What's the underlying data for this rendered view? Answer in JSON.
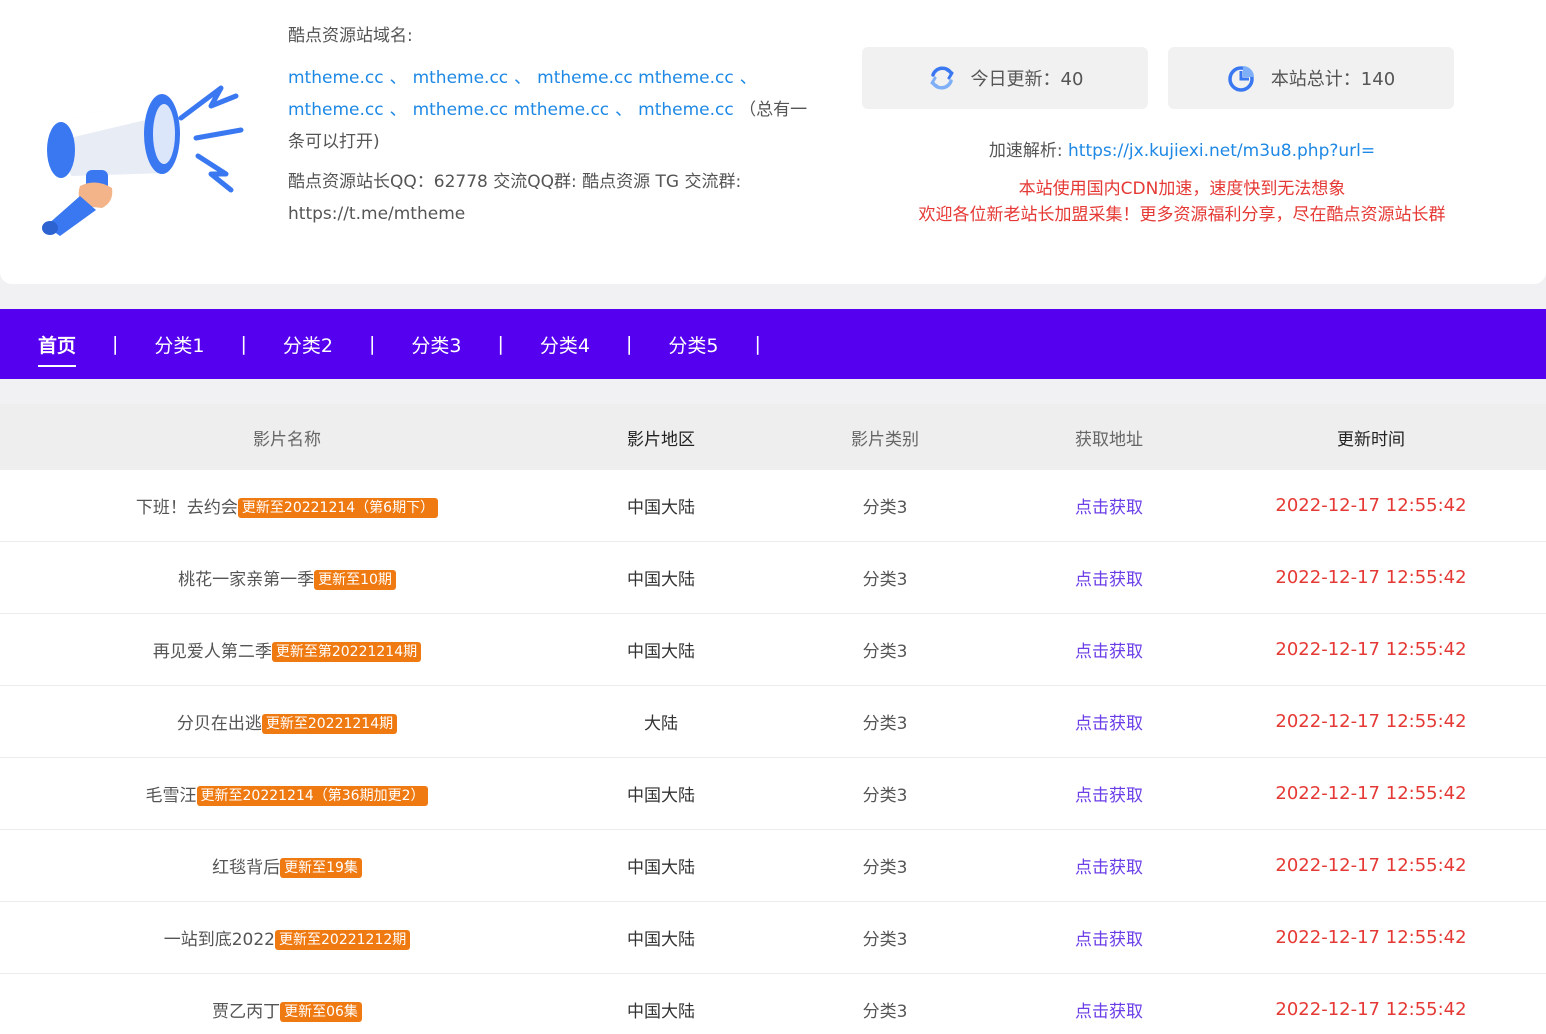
{
  "header": {
    "domain_title": "酷点资源站域名:",
    "domains": [
      "mtheme.cc",
      "mtheme.cc",
      "mtheme.cc mtheme.cc",
      "mtheme.cc",
      "mtheme.cc mtheme.cc",
      "mtheme.cc"
    ],
    "domain_note": "（总有一条可以打开)",
    "contact_line1": "酷点资源站长QQ：62778 交流QQ群: 酷点资源 TG 交流群:",
    "contact_line2": "https://t.me/mtheme",
    "stats": {
      "today_label": "今日更新：40",
      "total_label": "本站总计：140"
    },
    "accel_label": "加速解析: ",
    "accel_url": "https://jx.kujiexi.net/m3u8.php?url=",
    "notice_line1": "本站使用国内CDN加速，速度快到无法想象",
    "notice_line2": "欢迎各位新老站长加盟采集！更多资源福利分享，尽在酷点资源站长群"
  },
  "nav": {
    "items": [
      "首页",
      "分类1",
      "分类2",
      "分类3",
      "分类4",
      "分类5"
    ],
    "separator": "|",
    "active_index": 0
  },
  "table": {
    "headers": [
      "影片名称",
      "影片地区",
      "影片类别",
      "获取地址",
      "更新时间"
    ],
    "rows": [
      {
        "title": "下班！去约会",
        "badge": "更新至20221214（第6期下）",
        "region": "中国大陆",
        "category": "分类3",
        "link": "点击获取",
        "time": "2022-12-17 12:55:42"
      },
      {
        "title": "桃花一家亲第一季",
        "badge": "更新至10期",
        "region": "中国大陆",
        "category": "分类3",
        "link": "点击获取",
        "time": "2022-12-17 12:55:42"
      },
      {
        "title": "再见爱人第二季",
        "badge": "更新至第20221214期",
        "region": "中国大陆",
        "category": "分类3",
        "link": "点击获取",
        "time": "2022-12-17 12:55:42"
      },
      {
        "title": "分贝在出逃",
        "badge": "更新至20221214期",
        "region": "大陆",
        "category": "分类3",
        "link": "点击获取",
        "time": "2022-12-17 12:55:42"
      },
      {
        "title": "毛雪汪",
        "badge": "更新至20221214（第36期加更2）",
        "region": "中国大陆",
        "category": "分类3",
        "link": "点击获取",
        "time": "2022-12-17 12:55:42"
      },
      {
        "title": "红毯背后",
        "badge": "更新至19集",
        "region": "中国大陆",
        "category": "分类3",
        "link": "点击获取",
        "time": "2022-12-17 12:55:42"
      },
      {
        "title": "一站到底2022",
        "badge": "更新至20221212期",
        "region": "中国大陆",
        "category": "分类3",
        "link": "点击获取",
        "time": "2022-12-17 12:55:42"
      },
      {
        "title": "贾乙丙丁",
        "badge": "更新至06集",
        "region": "中国大陆",
        "category": "分类3",
        "link": "点击获取",
        "time": "2022-12-17 12:55:42"
      }
    ]
  },
  "colors": {
    "nav_bg": "#5500ee",
    "link_blue": "#1e88e5",
    "badge_orange": "#f07a12",
    "time_red": "#e53935",
    "get_link_purple": "#6a3de8"
  },
  "icons": {
    "hero": "megaphone-icon",
    "today": "refresh-icon",
    "total": "pie-chart-icon"
  }
}
